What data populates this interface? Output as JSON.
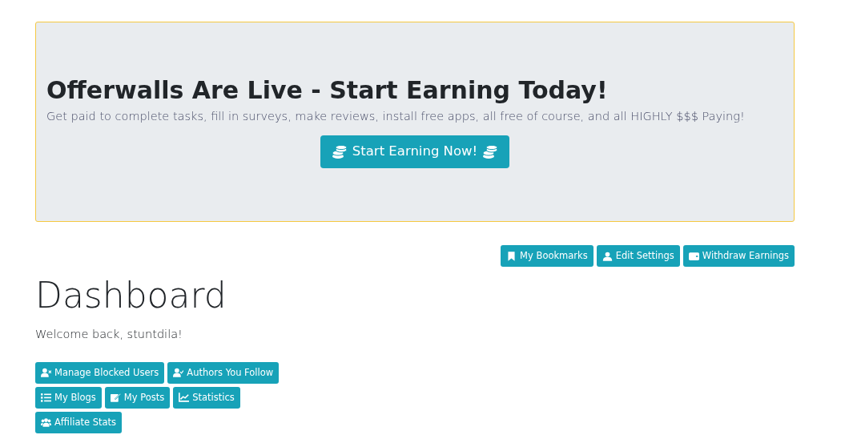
{
  "banner": {
    "title": "Offerwalls Are Live - Start Earning Today!",
    "text": "Get paid to complete tasks, fill in surveys, make reviews, install free apps, all free of course, and all HIGHLY $$$ Paying!",
    "button": "Start Earning Now!"
  },
  "top_buttons": [
    "My Bookmarks",
    "Edit Settings",
    "Withdraw Earnings"
  ],
  "page_title": "Dashboard",
  "welcome": "Welcome back, stuntdila!",
  "button_rows": [
    [
      "Manage Blocked Users",
      "Authors You Follow"
    ],
    [
      "My Blogs",
      "My Posts",
      "Statistics"
    ],
    [
      "Affiliate Stats"
    ]
  ]
}
